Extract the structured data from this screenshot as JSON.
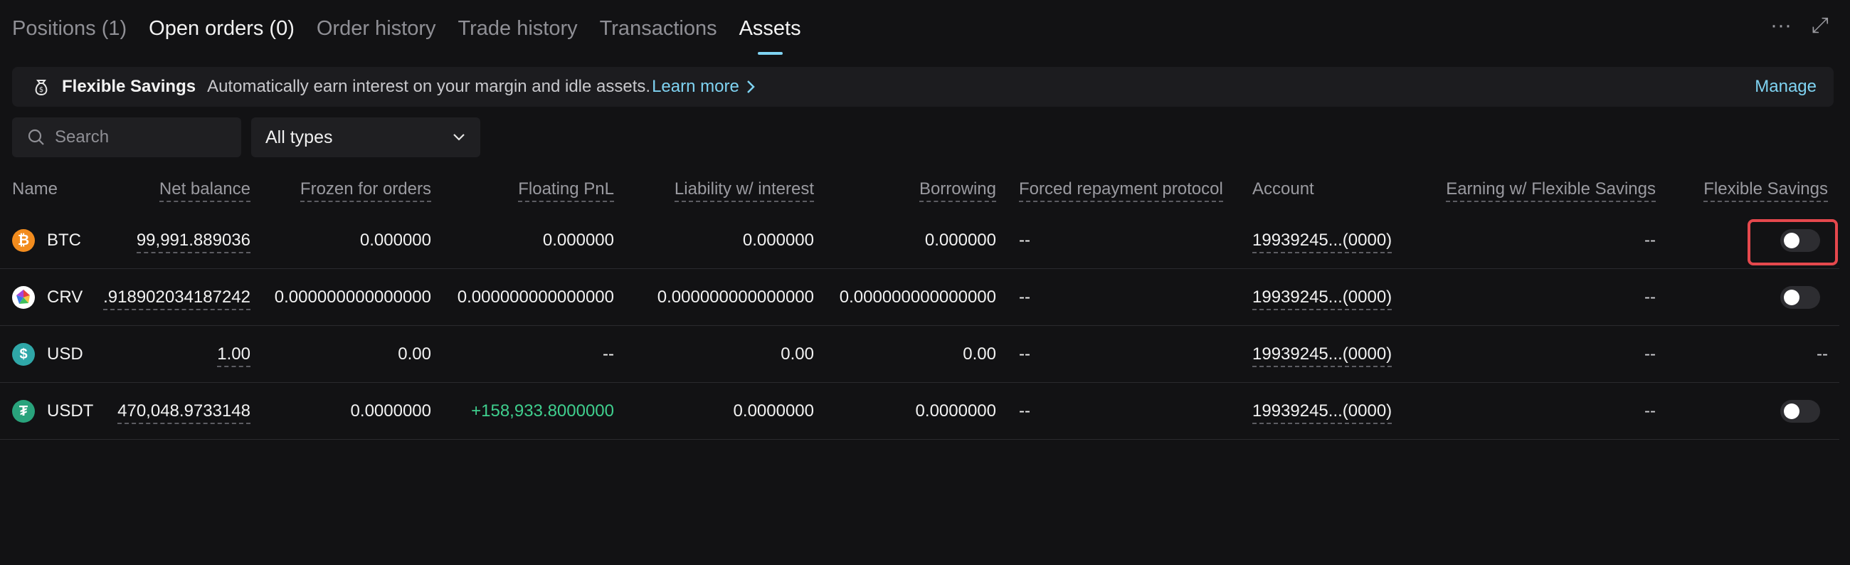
{
  "tabs": [
    {
      "label": "Positions (1)"
    },
    {
      "label": "Open orders (0)"
    },
    {
      "label": "Order history"
    },
    {
      "label": "Trade history"
    },
    {
      "label": "Transactions"
    },
    {
      "label": "Assets"
    }
  ],
  "top_actions": {
    "more": "···",
    "expand": "⤢"
  },
  "banner": {
    "title": "Flexible Savings",
    "description": "Automatically earn interest on your margin and idle assets.",
    "link": "Learn more",
    "manage": "Manage"
  },
  "filters": {
    "search_placeholder": "Search",
    "type_value": "All types"
  },
  "columns": {
    "name": "Name",
    "net_balance": "Net balance",
    "frozen": "Frozen for orders",
    "floating_pnl": "Floating PnL",
    "liability": "Liability w/ interest",
    "borrowing": "Borrowing",
    "forced": "Forced repayment protocol",
    "account": "Account",
    "earning": "Earning w/ Flexible Savings",
    "flexible": "Flexible Savings"
  },
  "rows": [
    {
      "coin": "BTC",
      "net_balance": "99,991.889036",
      "frozen": "0.000000",
      "floating_pnl": "0.000000",
      "liability": "0.000000",
      "borrowing": "0.000000",
      "forced": "--",
      "account": "19939245...(0000)",
      "earning": "--",
      "flexible": "toggle-off"
    },
    {
      "coin": "CRV",
      "net_balance": ".918902034187242",
      "frozen": "0.000000000000000",
      "floating_pnl": "0.000000000000000",
      "liability": "0.000000000000000",
      "borrowing": "0.000000000000000",
      "forced": "--",
      "account": "19939245...(0000)",
      "earning": "--",
      "flexible": "toggle-off"
    },
    {
      "coin": "USD",
      "net_balance": "1.00",
      "frozen": "0.00",
      "floating_pnl": "--",
      "liability": "0.00",
      "borrowing": "0.00",
      "forced": "--",
      "account": "19939245...(0000)",
      "earning": "--",
      "flexible": "--"
    },
    {
      "coin": "USDT",
      "net_balance": "470,048.9733148",
      "frozen": "0.0000000",
      "floating_pnl": "+158,933.8000000",
      "liability": "0.0000000",
      "borrowing": "0.0000000",
      "forced": "--",
      "account": "19939245...(0000)",
      "earning": "--",
      "flexible": "toggle-off"
    }
  ],
  "colors": {
    "accent": "#7fd3f2",
    "positive": "#3fcf8e",
    "highlight": "#e5484d",
    "background": "#121214"
  }
}
